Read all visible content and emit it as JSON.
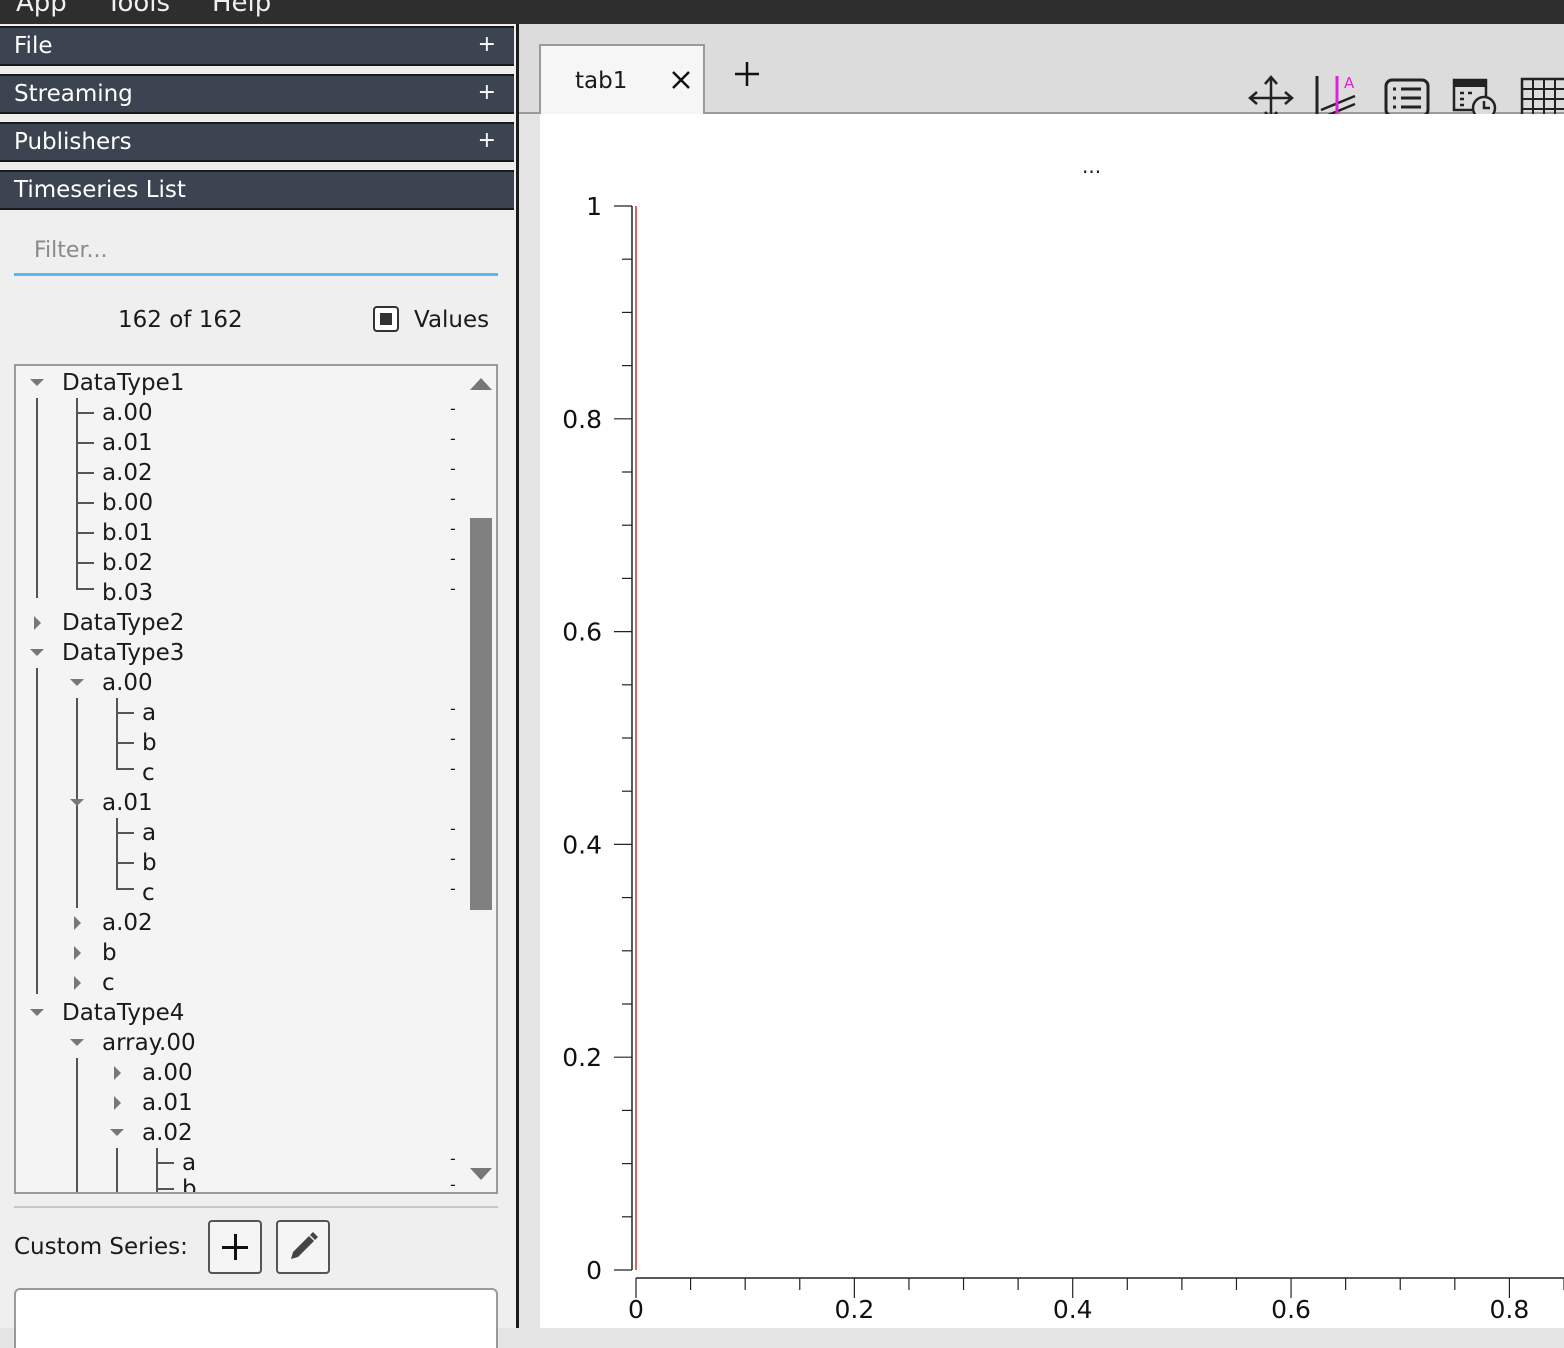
{
  "menu": [
    "App",
    "Tools",
    "Help"
  ],
  "sections": {
    "file": "File",
    "streaming": "Streaming",
    "publishers": "Publishers",
    "timeseries": "Timeseries List",
    "expand": "+"
  },
  "filter": {
    "placeholder": "Filter..."
  },
  "count": "162 of 162",
  "values_label": "Values",
  "tree_dash": "-",
  "tree": {
    "dt1": "DataType1",
    "dt1_a00": "a.00",
    "dt1_a01": "a.01",
    "dt1_a02": "a.02",
    "dt1_b00": "b.00",
    "dt1_b01": "b.01",
    "dt1_b02": "b.02",
    "dt1_b03": "b.03",
    "dt2": "DataType2",
    "dt3": "DataType3",
    "dt3_a00": "a.00",
    "dt3_a00_a": "a",
    "dt3_a00_b": "b",
    "dt3_a00_c": "c",
    "dt3_a01": "a.01",
    "dt3_a01_a": "a",
    "dt3_a01_b": "b",
    "dt3_a01_c": "c",
    "dt3_a02": "a.02",
    "dt3_b": "b",
    "dt3_c": "c",
    "dt4": "DataType4",
    "dt4_arr": "array.00",
    "dt4_a00": "a.00",
    "dt4_a01": "a.01",
    "dt4_a02": "a.02",
    "dt4_a02_a": "a",
    "dt4_a02_b": "b"
  },
  "custom_series": "Custom Series:",
  "tabs": {
    "tab1": "tab1"
  },
  "plot_title": "...",
  "colors": {
    "accent": "#5ab8f0",
    "panel_header": "#3b4450",
    "curve": "#c0392b",
    "icon_magenta": "#e020e0"
  },
  "icons": [
    "move-icon",
    "text-marker-icon",
    "legend-list-icon",
    "calendar-clock-icon",
    "grid-icon"
  ],
  "chart_data": {
    "type": "line",
    "title": "...",
    "xlim": [
      0,
      0.85
    ],
    "ylim": [
      0,
      1
    ],
    "xticks": [
      "0",
      "0.2",
      "0.4",
      "0.6",
      "0.8"
    ],
    "yticks": [
      "0",
      "0.2",
      "0.4",
      "0.6",
      "0.8",
      "1"
    ],
    "grid": false,
    "series": [
      {
        "x": [
          0,
          0
        ],
        "y": [
          0,
          1
        ]
      }
    ]
  }
}
